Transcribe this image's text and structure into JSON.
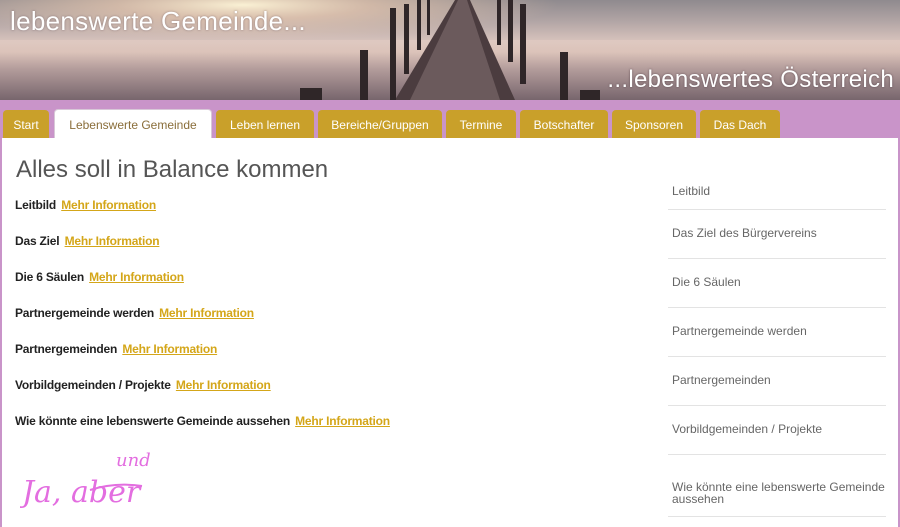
{
  "header": {
    "title": "lebenswerte Gemeinde...",
    "subtitle": "...lebenswertes Österreich"
  },
  "nav": {
    "tabs": [
      {
        "label": "Start",
        "active": false
      },
      {
        "label": "Lebenswerte Gemeinde",
        "active": true
      },
      {
        "label": "Leben lernen",
        "active": false
      },
      {
        "label": "Bereiche/Gruppen",
        "active": false
      },
      {
        "label": "Termine",
        "active": false
      },
      {
        "label": "Botschafter",
        "active": false
      },
      {
        "label": "Sponsoren",
        "active": false
      },
      {
        "label": "Das Dach",
        "active": false
      }
    ]
  },
  "main": {
    "title": "Alles soll in Balance kommen",
    "more_label": "Mehr Information",
    "rows": [
      {
        "label": "Leitbild"
      },
      {
        "label": "Das Ziel"
      },
      {
        "label": "Die 6 Säulen"
      },
      {
        "label": "Partnergemeinde werden"
      },
      {
        "label": "Partnergemeinden"
      },
      {
        "label": "Vorbildgemeinden / Projekte"
      },
      {
        "label": "Wie könnte eine lebenswerte Gemeinde aussehen"
      }
    ],
    "script_text": {
      "main": "Ja, aber",
      "top": "und"
    }
  },
  "sidebar": {
    "items": [
      {
        "label": "Leitbild"
      },
      {
        "label": "Das Ziel des Bürgervereins"
      },
      {
        "label": "Die 6 Säulen"
      },
      {
        "label": "Partnergemeinde werden"
      },
      {
        "label": "Partnergemeinden"
      },
      {
        "label": "Vorbildgemeinden / Projekte"
      },
      {
        "label": "Wie könnte eine lebenswerte Gemeinde aussehen"
      }
    ]
  },
  "colors": {
    "background": "#c994c9",
    "tab": "#c9a02a",
    "link": "#d4a619",
    "script": "#e36ee0"
  }
}
